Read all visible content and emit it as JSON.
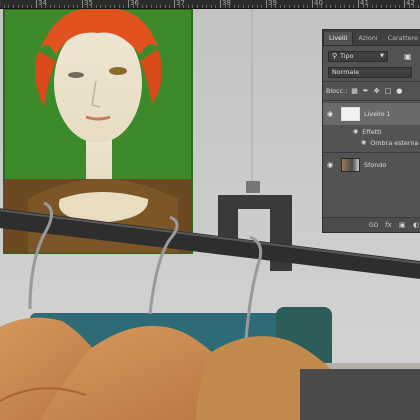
{
  "ruler": {
    "labels": [
      "33",
      "34",
      "35",
      "36",
      "37",
      "38",
      "39",
      "40",
      "41",
      "42"
    ]
  },
  "photo": {
    "palette": {
      "wall": "#cbcbc9",
      "painting_green": "#3e8a2a",
      "hair": "#e2521e",
      "wood": "#c98e55"
    }
  },
  "layers_panel": {
    "tabs": [
      {
        "label": "Livelli"
      },
      {
        "label": "Azioni"
      },
      {
        "label": "Carattere"
      }
    ],
    "filter": {
      "label": "Tipo"
    },
    "blend_mode": "Normale",
    "lock_label": "Blocc.:",
    "layers": {
      "layer1": {
        "name": "Livello 1"
      },
      "effects_label": "Effetti",
      "effect1_label": "Ombra esterna",
      "background": {
        "name": "Sfondo"
      }
    },
    "bottom": {
      "link": "GO",
      "fx": "fx"
    }
  },
  "colors": {
    "panel_bg": "#535353",
    "tab_bar": "#3f3f3f",
    "field_bg": "#3e3e3e",
    "selected_row": "#6a6a6a"
  }
}
